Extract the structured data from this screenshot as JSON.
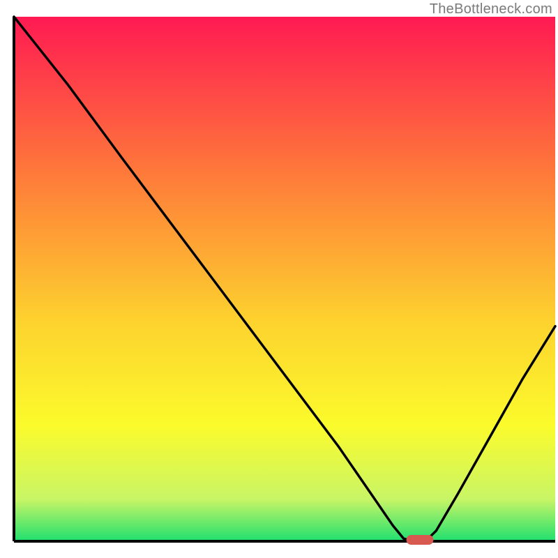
{
  "watermark": "TheBottleneck.com",
  "colors": {
    "gradient_top": "#ff1a52",
    "gradient_mid_upper": "#fe7a3a",
    "gradient_mid": "#fdd22e",
    "gradient_mid_lower": "#fbfb2c",
    "gradient_lower_yellowgreen": "#c8f566",
    "gradient_bottom": "#1fe06f",
    "axis": "#000000",
    "curve": "#000000",
    "marker_fill": "#d8594f",
    "marker_stroke": "#c94a40"
  },
  "chart_data": {
    "type": "line",
    "title": "",
    "xlabel": "",
    "ylabel": "",
    "xlim": [
      0,
      100
    ],
    "ylim": [
      0,
      100
    ],
    "grid": false,
    "legend": "none",
    "series": [
      {
        "name": "bottleneck-curve",
        "x": [
          0,
          10,
          20,
          28,
          36,
          44,
          52,
          60,
          66,
          70,
          72,
          74,
          76,
          78,
          82,
          88,
          94,
          100
        ],
        "y": [
          100,
          87,
          73,
          62,
          51,
          40,
          29,
          18,
          9,
          3,
          0.5,
          0,
          0,
          2,
          9,
          20,
          31,
          41
        ]
      }
    ],
    "marker": {
      "x_center": 75,
      "y": 0,
      "width_x": 5,
      "shape": "rounded-bar"
    },
    "_note": "y is read as percent of plot height from bottom; x as percent of plot width from left. Values estimated from gridless gradient plot."
  }
}
